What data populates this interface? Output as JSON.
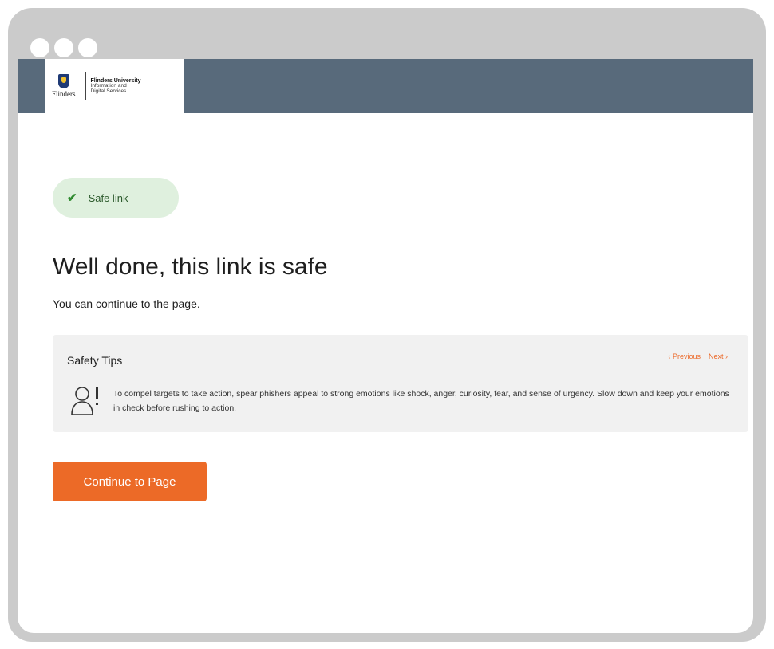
{
  "header": {
    "logo": {
      "wordmark": "Flinders",
      "line1": "Flinders University",
      "line2": "Information and",
      "line3": "Digital Services"
    }
  },
  "status_badge": {
    "label": "Safe link",
    "icon": "check-icon",
    "color": "#2f8a2f"
  },
  "main": {
    "title": "Well done, this link is safe",
    "subtitle": "You can continue to the page."
  },
  "safety_tips": {
    "title": "Safety Tips",
    "previous_label": "‹ Previous",
    "next_label": "Next ›",
    "icon": "person-alert-icon",
    "tip_text": "To compel targets to take action, spear phishers appeal to strong emotions like shock, anger, curiosity, fear, and sense of urgency. Slow down and keep your emotions in check before rushing to action."
  },
  "actions": {
    "continue_label": "Continue to Page"
  },
  "colors": {
    "header_bar": "#586a7b",
    "accent": "#ec6a27",
    "badge_bg": "#dff0de"
  }
}
